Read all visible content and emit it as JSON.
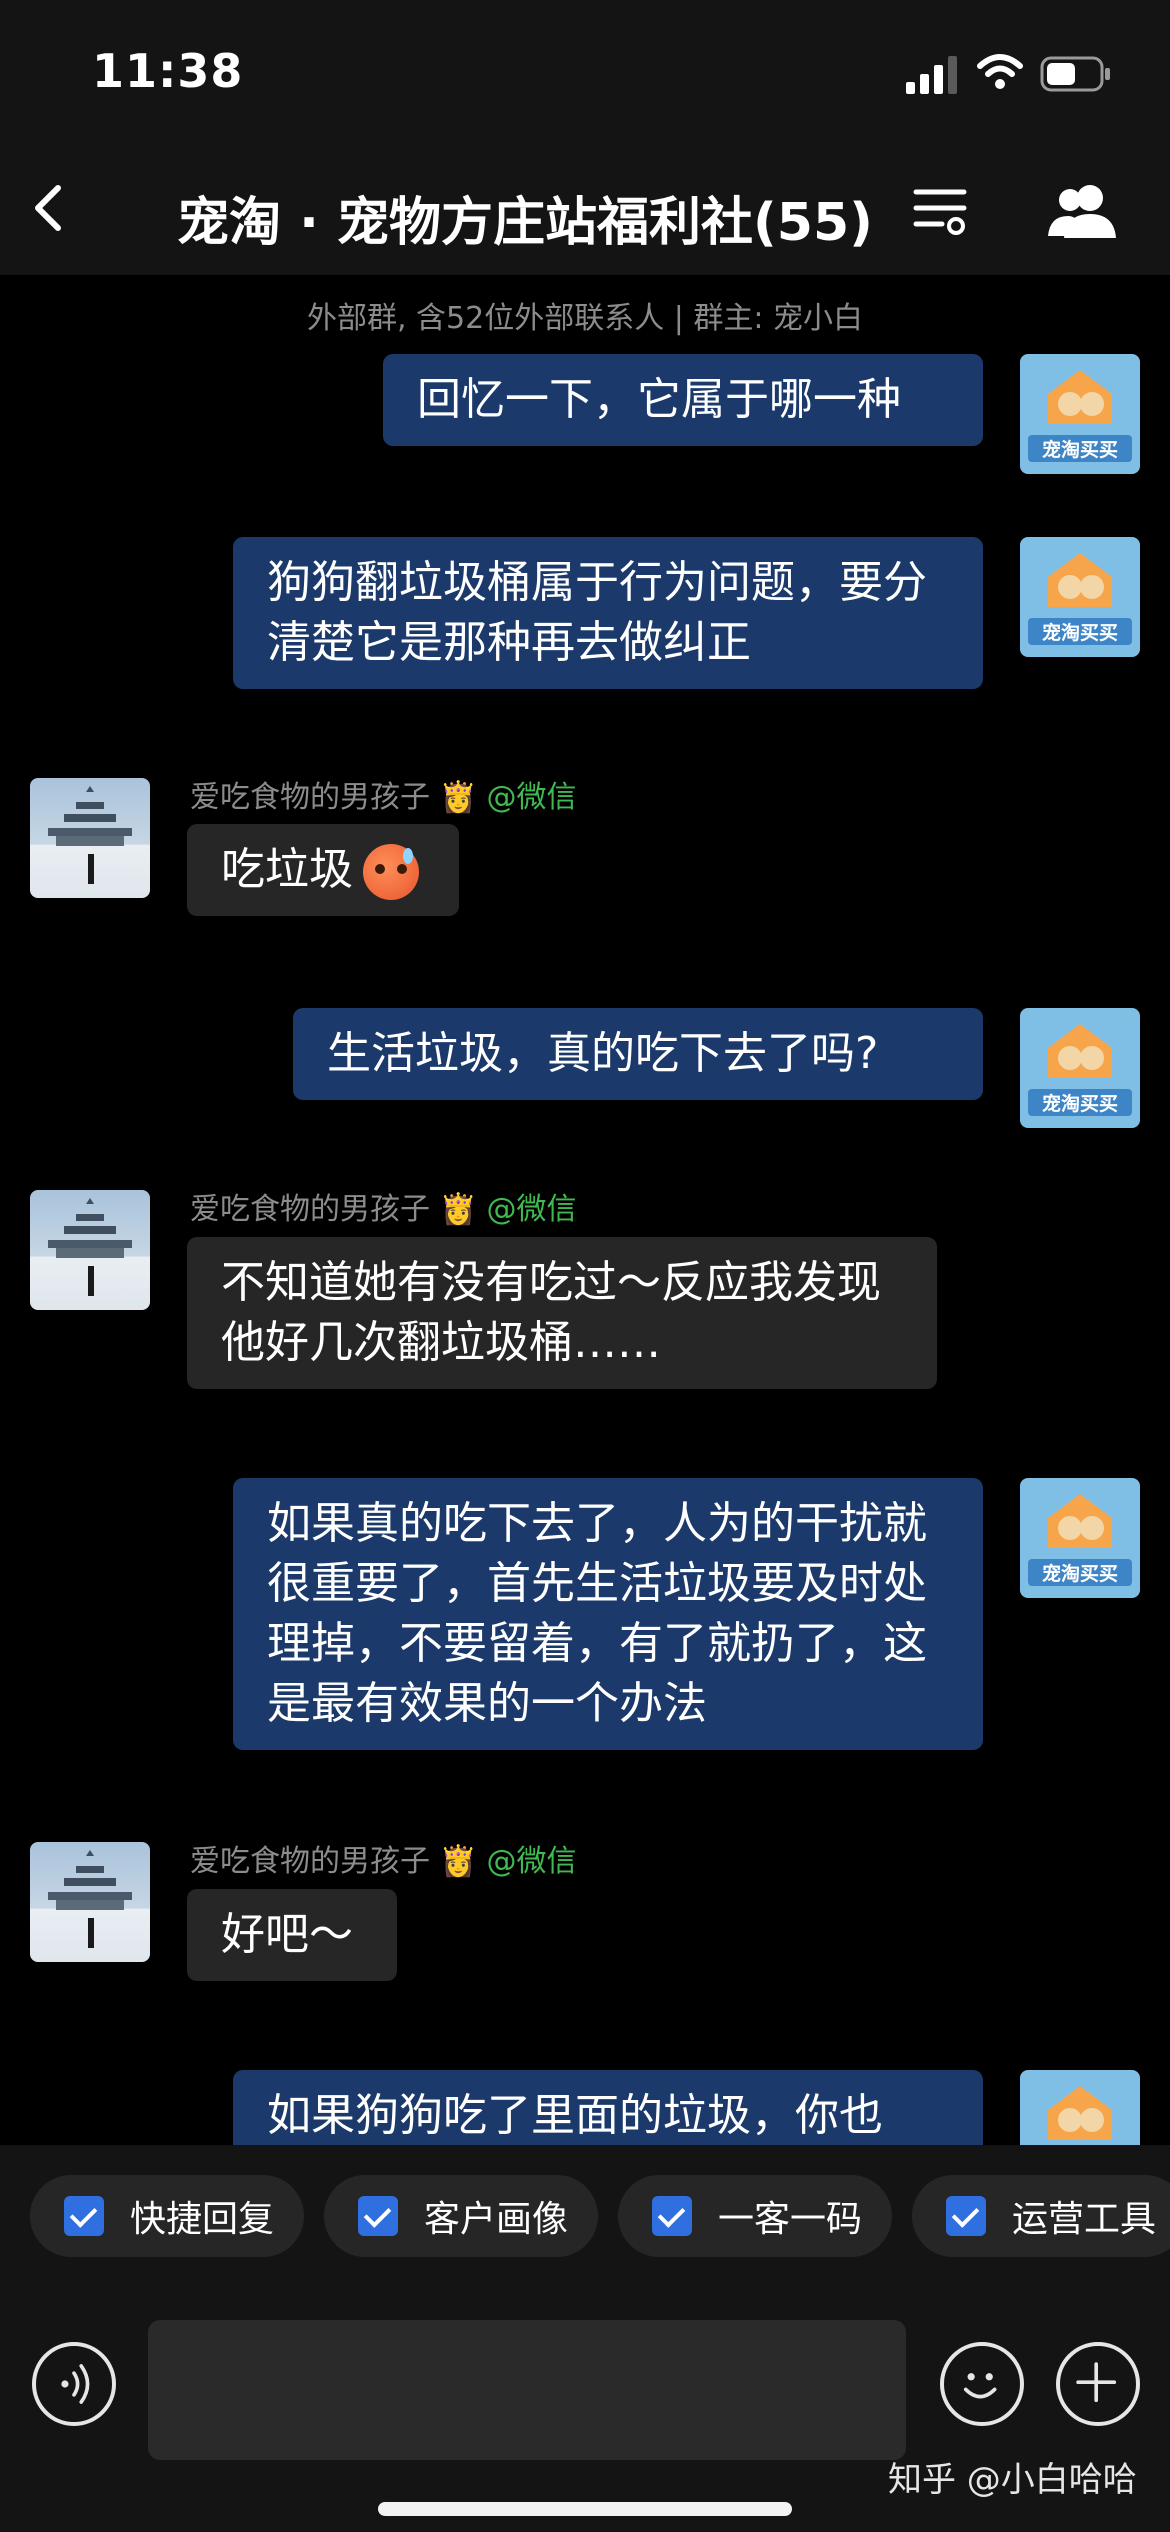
{
  "status": {
    "time": "11:38"
  },
  "nav": {
    "title": "宠淘 · 宠物方庄站福利社(55)"
  },
  "chat": {
    "notice": "外部群, 含52位外部联系人 | 群主: 宠小白",
    "my_avatar_tag": "宠淘买买",
    "sender_name": "爱吃食物的男孩子",
    "sender_suffix": "@微信",
    "messages": [
      {
        "from": "me",
        "text": "回忆一下，它属于哪一种"
      },
      {
        "from": "me",
        "text": "狗狗翻垃圾桶属于行为问题，要分清楚它是那种再去做纠正"
      },
      {
        "from": "other",
        "text": "吃垃圾"
      },
      {
        "from": "me",
        "text": "生活垃圾，真的吃下去了吗?"
      },
      {
        "from": "other",
        "text": "不知道她有没有吃过～反应我发现他好几次翻垃圾桶……"
      },
      {
        "from": "me",
        "text": "如果真的吃下去了，人为的干扰就很重要了，首先生活垃圾要及时处理掉，不要留着，有了就扔了，这是最有效果的一个办法"
      },
      {
        "from": "other",
        "text": "好吧～"
      },
      {
        "from": "me",
        "text": "如果狗狗吃了里面的垃圾，你也"
      }
    ]
  },
  "toolbar": {
    "items": [
      {
        "label": "快捷回复"
      },
      {
        "label": "客户画像"
      },
      {
        "label": "一客一码"
      },
      {
        "label": "运营工具"
      }
    ]
  },
  "input": {
    "value": ""
  },
  "watermark": "知乎 @小白哈哈",
  "colors": {
    "my_bubble": "#1b3a6b",
    "other_bubble": "#262626",
    "check_blue": "#2f6fe0",
    "wechat_green": "#3fb950"
  }
}
